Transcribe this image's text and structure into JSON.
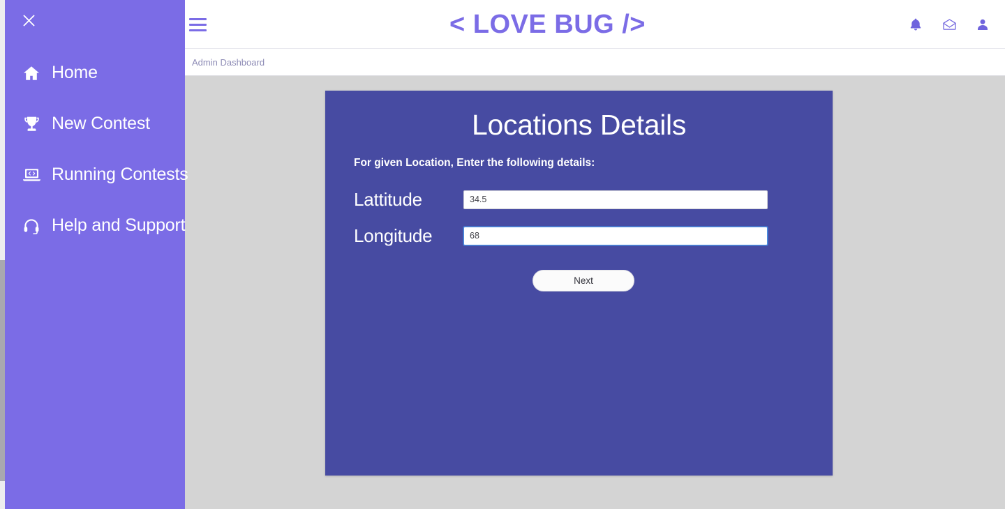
{
  "app": {
    "brand": "< LOVE BUG />",
    "accent_color": "#7b6ce6",
    "card_color": "#474ba2",
    "content_bg": "#d4d4d4"
  },
  "sidebar": {
    "close_label": "close-sidebar",
    "items": [
      {
        "label": "Home",
        "icon": "home-icon"
      },
      {
        "label": "New Contest",
        "icon": "trophy-icon"
      },
      {
        "label": "Running Contests",
        "icon": "laptop-code-icon"
      },
      {
        "label": "Help and Support",
        "icon": "headset-icon"
      }
    ]
  },
  "topbar": {
    "menu_icon": "hamburger-icon",
    "actions": [
      {
        "name": "notifications",
        "icon": "bell-icon"
      },
      {
        "name": "messages",
        "icon": "envelope-icon"
      },
      {
        "name": "account",
        "icon": "user-icon"
      }
    ]
  },
  "breadcrumb": {
    "text": "Admin Dashboard"
  },
  "card": {
    "title": "Locations Details",
    "subtitle": "For given Location, Enter the following details:",
    "fields": [
      {
        "label": "Lattitude",
        "value": "34.5",
        "placeholder": "",
        "focused": false
      },
      {
        "label": "Longitude",
        "value": "68",
        "placeholder": "",
        "focused": true
      }
    ],
    "next_label": "Next"
  }
}
